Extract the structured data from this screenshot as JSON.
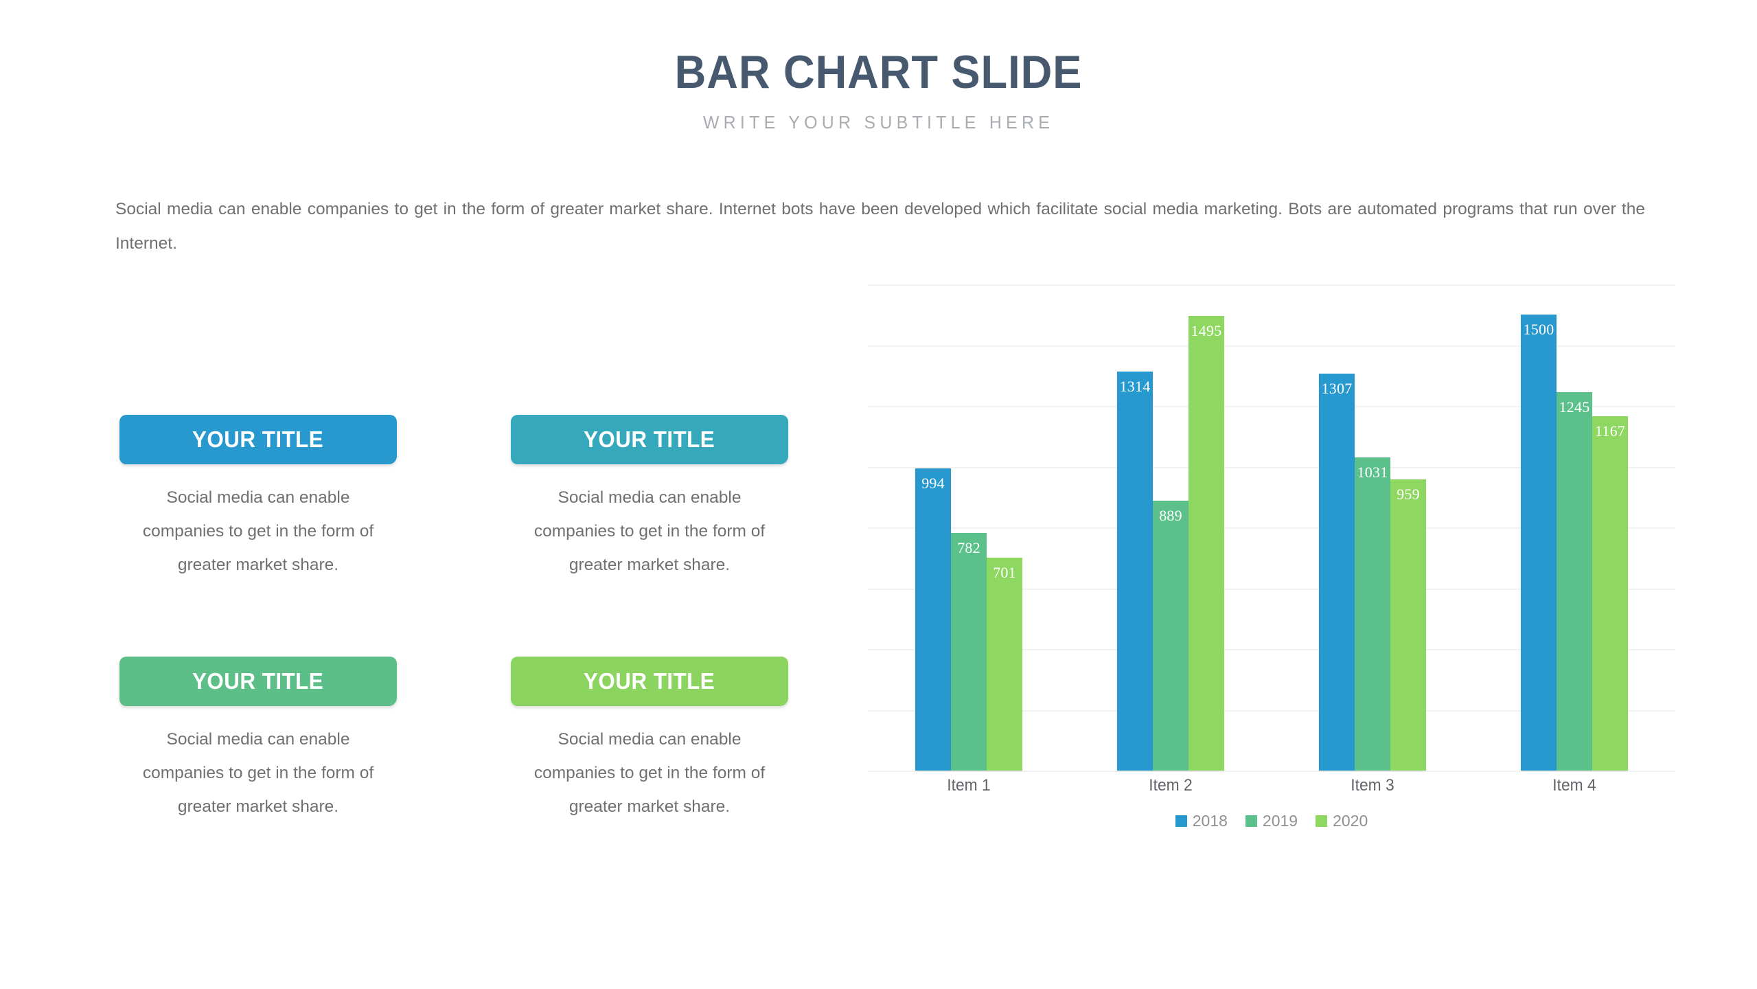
{
  "header": {
    "title": "BAR CHART SLIDE",
    "subtitle": "WRITE YOUR SUBTITLE HERE"
  },
  "intro": {
    "paragraph": "Social media can enable companies to get in the form of greater market share. Internet bots have been developed which facilitate social media marketing. Bots are automated programs that run over the Internet."
  },
  "features": [
    {
      "title": "YOUR TITLE",
      "body": "Social media can enable companies to get in the form of greater market share.",
      "color": "#2799ce"
    },
    {
      "title": "YOUR TITLE",
      "body": "Social media can enable companies to get in the form of greater market share.",
      "color": "#35a8bb"
    },
    {
      "title": "YOUR TITLE",
      "body": "Social media can enable companies to get in the form of greater market share.",
      "color": "#5cbf87"
    },
    {
      "title": "YOUR TITLE",
      "body": "Social media can enable companies to get in the form of greater market share.",
      "color": "#8bd45f"
    }
  ],
  "chart_data": {
    "type": "bar",
    "title": "",
    "xlabel": "",
    "ylabel": "",
    "categories": [
      "Item 1",
      "Item 2",
      "Item 3",
      "Item 4"
    ],
    "series": [
      {
        "name": "2018",
        "color": "#2799ce",
        "values": [
          994,
          1314,
          1307,
          1500
        ]
      },
      {
        "name": "2019",
        "color": "#5cc08b",
        "values": [
          782,
          889,
          1031,
          1245
        ]
      },
      {
        "name": "2020",
        "color": "#8ed862",
        "values": [
          701,
          1495,
          959,
          1167
        ]
      }
    ],
    "ylim": [
      0,
      1600
    ],
    "gridlines": 9,
    "grid": true,
    "legend_position": "bottom",
    "show_value_labels": true
  }
}
